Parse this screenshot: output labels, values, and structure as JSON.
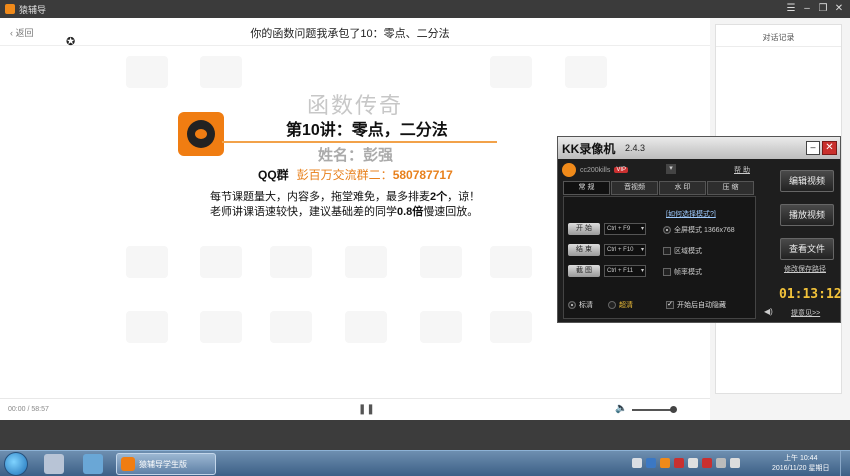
{
  "window": {
    "app_name": "猿辅导"
  },
  "nav": {
    "back_label": "返回",
    "lesson_title": "你的函数问题我承包了10：零点、二分法"
  },
  "slide": {
    "title": "函数传奇",
    "lecture": "第10讲：零点，二分法",
    "teacher": "姓名：彭强",
    "qq_label": "QQ群",
    "qq_group": "彭百万交流群二：",
    "qq_number": "580787717",
    "note1_pre": "每节课题量大，内容多，拖堂难免，最多排麦",
    "note1_num": "2个",
    "note1_post": "，谅！",
    "note2_pre": "老师讲课语速较快，建议基础差的同学",
    "note2_num": "0.8倍",
    "note2_post": "慢速回放。"
  },
  "side_panel": {
    "title": "对话记录"
  },
  "player": {
    "time": "00:00 / 58:57"
  },
  "kk": {
    "title": "KK录像机",
    "version": "2.4.3",
    "username": "cc200kills",
    "vip": "VIP",
    "help": "帮 助",
    "tabs": [
      "常 规",
      "音视频",
      "水 印",
      "压 缩"
    ],
    "mode_link": "[如何选择模式?]",
    "start": "开 始",
    "stop": "结 束",
    "snapshot": "截 图",
    "key_start": "Ctrl + F9",
    "key_stop": "Ctrl + F10",
    "key_snap": "Ctrl + F11",
    "mode_full": "全屏模式  1366x768",
    "mode_region": "区域模式",
    "mode_frame": "帧率模式",
    "quality_std": "标清",
    "quality_hd": "超清",
    "auto_hide": "开始后自动隐藏",
    "edit_video": "编辑视频",
    "play_video": "播放视频",
    "view_files": "查看文件",
    "change_path": "修改保存路径",
    "timer": "01:13:12",
    "tips": "提意见>>"
  },
  "taskbar": {
    "task_label": "猿辅导学生版",
    "time": "上午 10:44",
    "date": "2016/11/20 星期日"
  },
  "colors": {
    "brand_orange": "#f07d12",
    "kk_timer": "#f2c23a",
    "taskbar": "#4a6d94"
  }
}
